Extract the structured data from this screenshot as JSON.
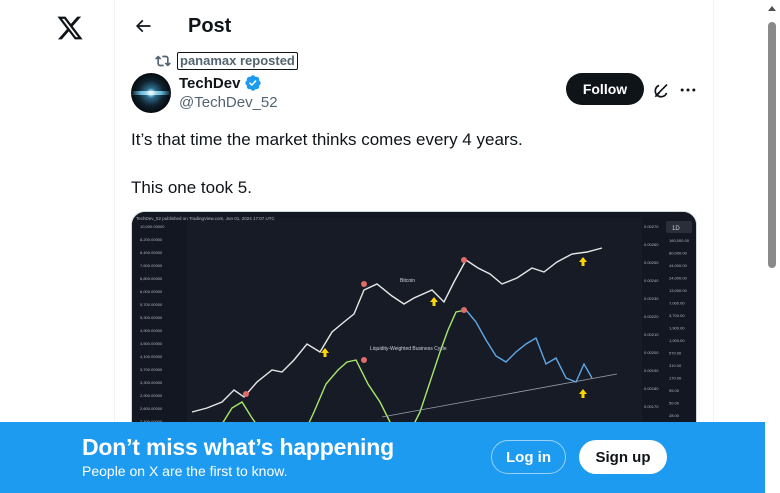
{
  "header": {
    "title": "Post"
  },
  "repost": {
    "label": "panamax reposted"
  },
  "author": {
    "name": "TechDev",
    "handle": "@TechDev_52"
  },
  "actions": {
    "follow_label": "Follow"
  },
  "tweet": {
    "line1": "It’s that time the market thinks comes every 4 years.",
    "line2": "This one took 5."
  },
  "media": {
    "caption": "TechDev_52 published on TradingView.com, Jun 01, 2024 17:07 UTC",
    "label_bitcoin": "Bitcoin",
    "label_cycle": "Liquidity-Weighted Business Cycle",
    "timeframe": "1D",
    "left_axis": [
      "10,000.00000",
      "8,200.00000",
      "6,400.00000",
      "7,600.00000",
      "6,800.00000",
      "6,000.00000",
      "5,700.00000",
      "5,300.00000",
      "4,900.00000",
      "4,500.00000",
      "4,100.00000",
      "3,700.00000",
      "3,300.00000",
      "2,900.00000",
      "2,600.00000",
      "2,400.00000"
    ],
    "mid_axis": [
      "0.00270",
      "0.00260",
      "0.00250",
      "0.00240",
      "0.00230",
      "0.00220",
      "0.00210",
      "0.00200",
      "0.00190",
      "0.00180",
      "0.00170",
      "0.00160"
    ],
    "right_axis": [
      "160,000.00",
      "80,000.00",
      "44,000.00",
      "24,000.00",
      "13,000.00",
      "7,000.00",
      "3,700.00",
      "1,900.00",
      "1,000.00",
      "570.00",
      "310.00",
      "170.00",
      "95.00",
      "50.00",
      "28.00",
      "14.00",
      "7.50"
    ]
  },
  "banner": {
    "headline": "Don’t miss what’s happening",
    "subtext": "People on X are the first to know.",
    "login_label": "Log in",
    "signup_label": "Sign up"
  },
  "icons": {
    "logo": "x-logo-icon",
    "back": "arrow-left-icon",
    "repost": "repost-icon",
    "verified": "verified-badge-icon",
    "grok": "grok-icon",
    "more": "more-icon"
  },
  "colors": {
    "brand_blue": "#1d9bf0",
    "text": "#0f1419",
    "secondary": "#536471",
    "chart_bg": "#131722"
  }
}
